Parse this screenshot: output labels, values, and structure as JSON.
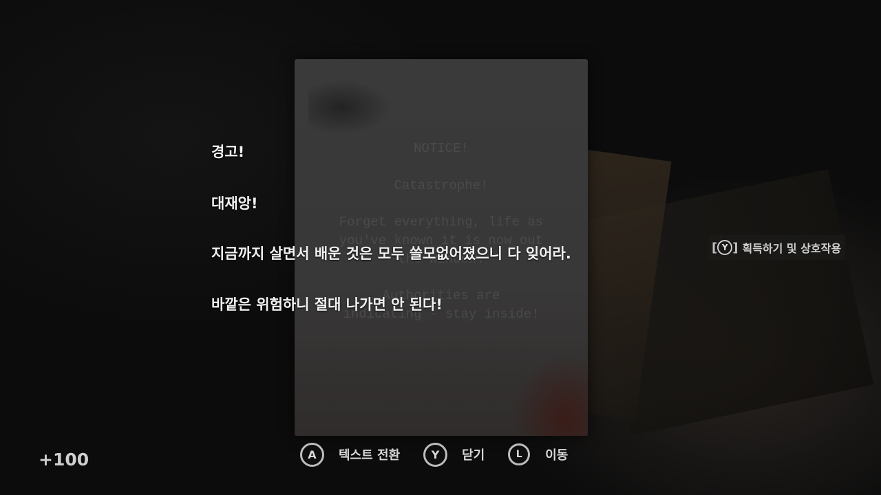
{
  "note": {
    "title": "NOTICE!",
    "line1": "Catastrophe!",
    "body": "Forget everything, life as\nyou've known it is now out\nthe window.",
    "body2": "Authorities are\nindicating - stay inside!"
  },
  "subtitles": {
    "line1": "경고!",
    "line2": "대재앙!",
    "line3": "지금까지 살면서 배운 것은 모두 쓸모없어졌으니 다 잊어라.",
    "line4": "바깥은 위험하니 절대 나가면 안 된다!"
  },
  "prompt": {
    "open_bracket": "[",
    "button": "Y",
    "close_bracket": "]",
    "label": "획득하기 및 상호작용"
  },
  "controls": [
    {
      "button": "A",
      "label": "텍스트 전환"
    },
    {
      "button": "Y",
      "label": "닫기"
    },
    {
      "button": "L",
      "label": "이동"
    }
  ],
  "score": "+100"
}
